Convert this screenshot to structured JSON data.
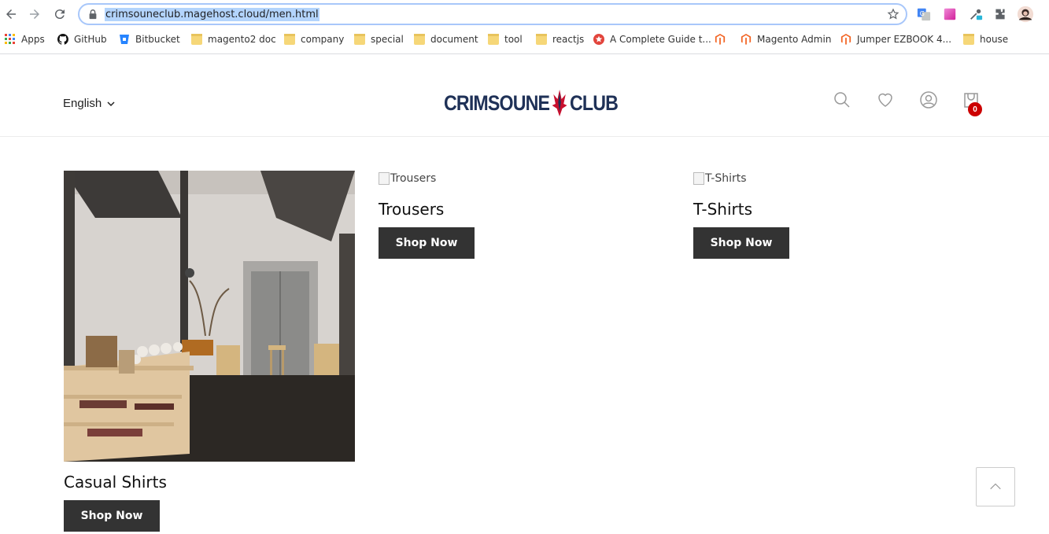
{
  "browser": {
    "url": "crimsouneclub.magehost.cloud/men.html",
    "bookmarks": [
      {
        "label": "Apps",
        "icon": "apps-grid-icon"
      },
      {
        "label": "GitHub",
        "icon": "github-icon"
      },
      {
        "label": "Bitbucket",
        "icon": "bitbucket-icon"
      },
      {
        "label": "magento2 doc",
        "icon": "folder-icon"
      },
      {
        "label": "company",
        "icon": "folder-icon"
      },
      {
        "label": "special",
        "icon": "folder-icon"
      },
      {
        "label": "document",
        "icon": "folder-icon"
      },
      {
        "label": "tool",
        "icon": "folder-icon"
      },
      {
        "label": "reactjs",
        "icon": "folder-icon"
      },
      {
        "label": "A Complete Guide t...",
        "icon": "star-badge-icon"
      },
      {
        "label": "",
        "icon": "magento-icon"
      },
      {
        "label": "Magento Admin",
        "icon": "magento-icon"
      },
      {
        "label": "Jumper EZBOOK 4...",
        "icon": "magento-icon"
      },
      {
        "label": "house",
        "icon": "folder-icon"
      }
    ]
  },
  "header": {
    "language": "English",
    "logo_left": "CRIMSOUNE",
    "logo_right": "CLUB",
    "cart_count": "0"
  },
  "categories": [
    {
      "title": "Casual Shirts",
      "button": "Shop Now",
      "image_alt": ""
    },
    {
      "title": "Trousers",
      "button": "Shop Now",
      "image_alt": "Trousers"
    },
    {
      "title": "T-Shirts",
      "button": "Shop Now",
      "image_alt": "T-Shirts"
    }
  ],
  "colors": {
    "brand_navy": "#1f3157",
    "button_bg": "#333333",
    "badge_red": "#cc0000"
  }
}
